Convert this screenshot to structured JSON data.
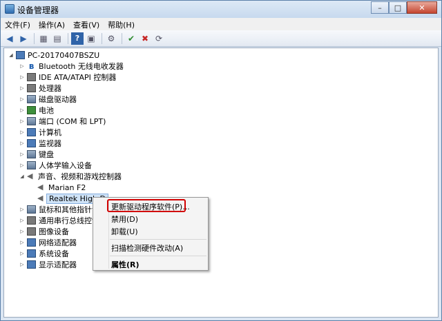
{
  "window": {
    "title": "设备管理器",
    "controls": [
      "–",
      "□",
      "✕"
    ]
  },
  "menu": [
    "文件(F)",
    "操作(A)",
    "查看(V)",
    "帮助(H)"
  ],
  "toolbar": [
    "◀",
    "▶",
    "▦",
    "▤",
    "?",
    "▣",
    "⚙",
    "✔",
    "✖",
    "⟳"
  ],
  "tree": {
    "root": "PC-20170407BSZU",
    "items": [
      {
        "label": "Bluetooth 无线电收发器",
        "icon": "bluetooth-icon"
      },
      {
        "label": "IDE ATA/ATAPI 控制器",
        "icon": "ide-controller-icon"
      },
      {
        "label": "处理器",
        "icon": "processor-icon"
      },
      {
        "label": "磁盘驱动器",
        "icon": "disk-drive-icon"
      },
      {
        "label": "电池",
        "icon": "battery-icon"
      },
      {
        "label": "端口 (COM 和 LPT)",
        "icon": "port-icon"
      },
      {
        "label": "计算机",
        "icon": "computer-icon"
      },
      {
        "label": "监视器",
        "icon": "monitor-icon"
      },
      {
        "label": "键盘",
        "icon": "keyboard-icon"
      },
      {
        "label": "人体学输入设备",
        "icon": "hid-icon"
      },
      {
        "label": "声音、视频和游戏控制器",
        "icon": "sound-icon",
        "expanded": true,
        "children": [
          "Marian F2",
          "Realtek High Definition Audio"
        ]
      },
      {
        "label": "鼠标和其他指针设备",
        "icon": "mouse-icon"
      },
      {
        "label": "通用串行总线控制器",
        "icon": "usb-icon"
      },
      {
        "label": "图像设备",
        "icon": "imaging-icon"
      },
      {
        "label": "网络适配器",
        "icon": "network-icon"
      },
      {
        "label": "系统设备",
        "icon": "system-icon"
      },
      {
        "label": "显示适配器",
        "icon": "display-adapter-icon"
      }
    ],
    "selected_child_visible": "Realtek High D"
  },
  "context_menu": [
    "更新驱动程序软件(P)...",
    "禁用(D)",
    "卸载(U)",
    "扫描检测硬件改动(A)",
    "属性(R)"
  ],
  "highlight_color": "#d10000"
}
